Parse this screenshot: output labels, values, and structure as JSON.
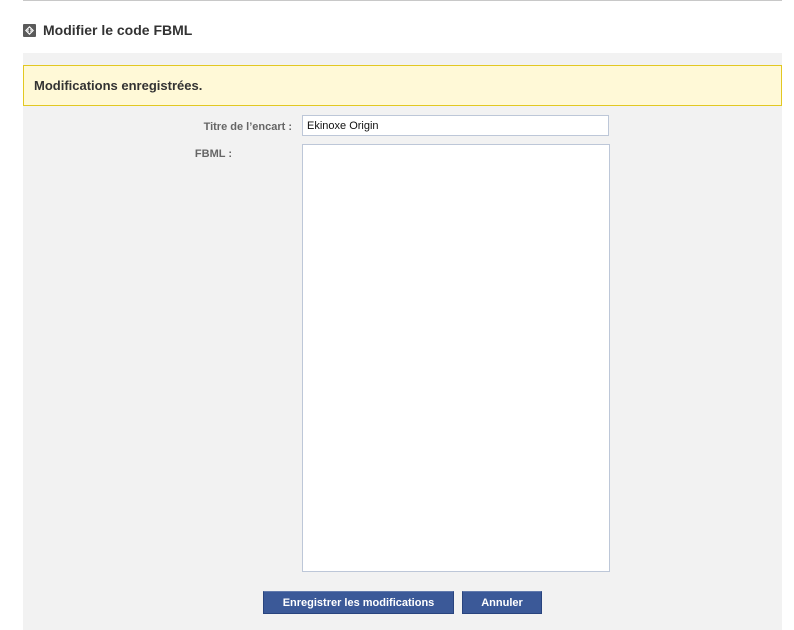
{
  "header": {
    "title": "Modifier le code FBML",
    "icon": "fbml-code-icon"
  },
  "notice": {
    "message": "Modifications enregistrées."
  },
  "form": {
    "title_label": "Titre de l’encart :",
    "title_value": "Ekinoxe Origin",
    "fbml_label": "FBML :",
    "fbml_value": ""
  },
  "buttons": {
    "save_label": "Enregistrer les modifications",
    "cancel_label": "Annuler"
  },
  "colors": {
    "notice_bg": "#fff9d7",
    "notice_border": "#e2c822",
    "button_bg": "#3b5998",
    "panel_bg": "#f2f2f2"
  }
}
